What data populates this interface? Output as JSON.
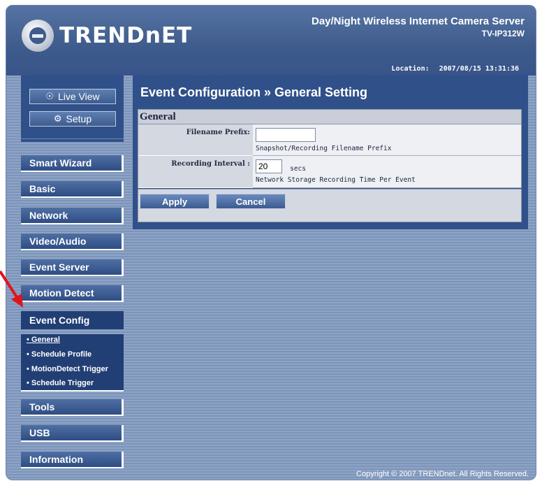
{
  "header": {
    "brand": "TRENDnET",
    "product_name": "Day/Night Wireless Internet Camera Server",
    "model": "TV-IP312W",
    "location_label": "Location:",
    "datetime": "2007/08/15 13:31:36"
  },
  "top_buttons": {
    "live_view": "Live View",
    "setup": "Setup"
  },
  "nav": {
    "smart_wizard": "Smart Wizard",
    "basic": "Basic",
    "network": "Network",
    "video_audio": "Video/Audio",
    "event_server": "Event Server",
    "motion_detect": "Motion Detect",
    "event_config": "Event Config",
    "tools": "Tools",
    "usb": "USB",
    "information": "Information"
  },
  "event_config_sub": [
    "General",
    "Schedule Profile",
    "MotionDetect Trigger",
    "Schedule Trigger"
  ],
  "page": {
    "title": "Event Configuration » General Setting",
    "section": "General",
    "filename_prefix_label": "Filename Prefix:",
    "filename_prefix_value": "",
    "filename_prefix_hint": "Snapshot/Recording Filename Prefix",
    "recording_interval_label": "Recording Interval :",
    "recording_interval_value": "20",
    "recording_interval_unit": "secs",
    "recording_interval_hint": "Network Storage Recording Time Per Event",
    "apply": "Apply",
    "cancel": "Cancel"
  },
  "footer": {
    "copyright": "Copyright © 2007 TRENDnet. All Rights Reserved."
  },
  "colors": {
    "header": "#3e5b8c",
    "panel": "#30508a",
    "nav_active": "#213f74",
    "annotation_arrow": "#e0141b"
  }
}
